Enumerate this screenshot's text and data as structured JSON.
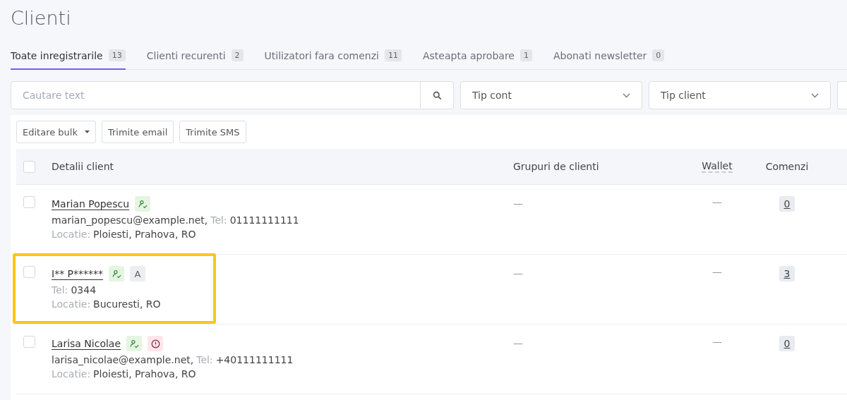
{
  "page_title": "Clienti",
  "tabs": [
    {
      "label": "Toate inregistrarile",
      "count": "13",
      "selected": true
    },
    {
      "label": "Clienti recurenti",
      "count": "2",
      "selected": false
    },
    {
      "label": "Utilizatori fara comenzi",
      "count": "11",
      "selected": false
    },
    {
      "label": "Asteapta aprobare",
      "count": "1",
      "selected": false
    },
    {
      "label": "Abonati newsletter",
      "count": "0",
      "selected": false
    }
  ],
  "search": {
    "placeholder": "Cautare text"
  },
  "filters": [
    {
      "placeholder": "Tip cont"
    },
    {
      "placeholder": "Tip client"
    },
    {
      "kind": "cut"
    }
  ],
  "bulk_actions": [
    {
      "label": "Editare bulk",
      "dropdown": true
    },
    {
      "label": "Trimite email",
      "dropdown": false
    },
    {
      "label": "Trimite SMS",
      "dropdown": false
    }
  ],
  "table": {
    "select_all_checked": false,
    "columns": [
      "Detalii client",
      "Grupuri de clienti",
      "Wallet",
      "Comenzi"
    ],
    "rows": [
      {
        "name": "Marian Popescu",
        "badges": [
          {
            "kind": "verified"
          }
        ],
        "lines": [
          [
            {
              "kind": "value",
              "text": "marian_popescu@example.net,"
            },
            {
              "kind": "label",
              "text": "Tel:"
            },
            {
              "kind": "value",
              "text": "01111111111"
            }
          ],
          [
            {
              "kind": "label",
              "text": "Locatie:"
            },
            {
              "kind": "value",
              "text": "Ploiesti, Prahova, RO"
            }
          ]
        ],
        "groups": "—",
        "wallet": "—",
        "orders": "0",
        "checked": false,
        "highlighted": false
      },
      {
        "name": "I** P******",
        "badges": [
          {
            "kind": "verified"
          },
          {
            "kind": "letter",
            "text": "A"
          }
        ],
        "lines": [
          [
            {
              "kind": "label",
              "text": "Tel:"
            },
            {
              "kind": "value",
              "text": "0344"
            }
          ],
          [
            {
              "kind": "label",
              "text": "Locatie:"
            },
            {
              "kind": "value",
              "text": "Bucuresti, RO"
            }
          ]
        ],
        "groups": "—",
        "wallet": "—",
        "orders": "3",
        "checked": false,
        "highlighted": true
      },
      {
        "name": "Larisa Nicolae",
        "badges": [
          {
            "kind": "verified"
          },
          {
            "kind": "warning"
          }
        ],
        "lines": [
          [
            {
              "kind": "value",
              "text": "larisa_nicolae@example.net,"
            },
            {
              "kind": "label",
              "text": "Tel:"
            },
            {
              "kind": "value",
              "text": "+40111111111"
            }
          ],
          [
            {
              "kind": "label",
              "text": "Locatie:"
            },
            {
              "kind": "value",
              "text": "Ploiesti, Prahova, RO"
            }
          ]
        ],
        "groups": "—",
        "wallet": "—",
        "orders": "0",
        "checked": false,
        "highlighted": false
      }
    ]
  }
}
